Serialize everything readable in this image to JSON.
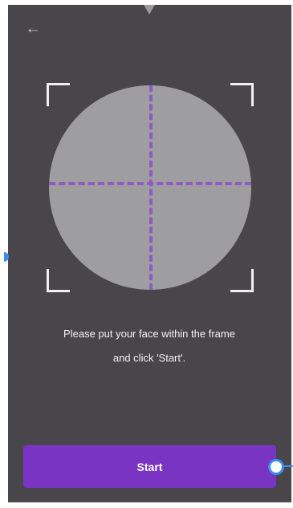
{
  "header": {
    "back_icon": "arrow-left-icon",
    "back_glyph": "←"
  },
  "capture": {
    "frame_color": "#f0f0f0",
    "circle_color": "#9e9d9f",
    "crosshair_color": "#8f5ac4"
  },
  "instruction": {
    "line1": "Please put your face within the frame",
    "line2": "and click 'Start'."
  },
  "actions": {
    "start_label": "Start",
    "start_color": "#7a34c4"
  },
  "colors": {
    "background": "#48464b",
    "selection_handle": "#3d8cf0"
  }
}
